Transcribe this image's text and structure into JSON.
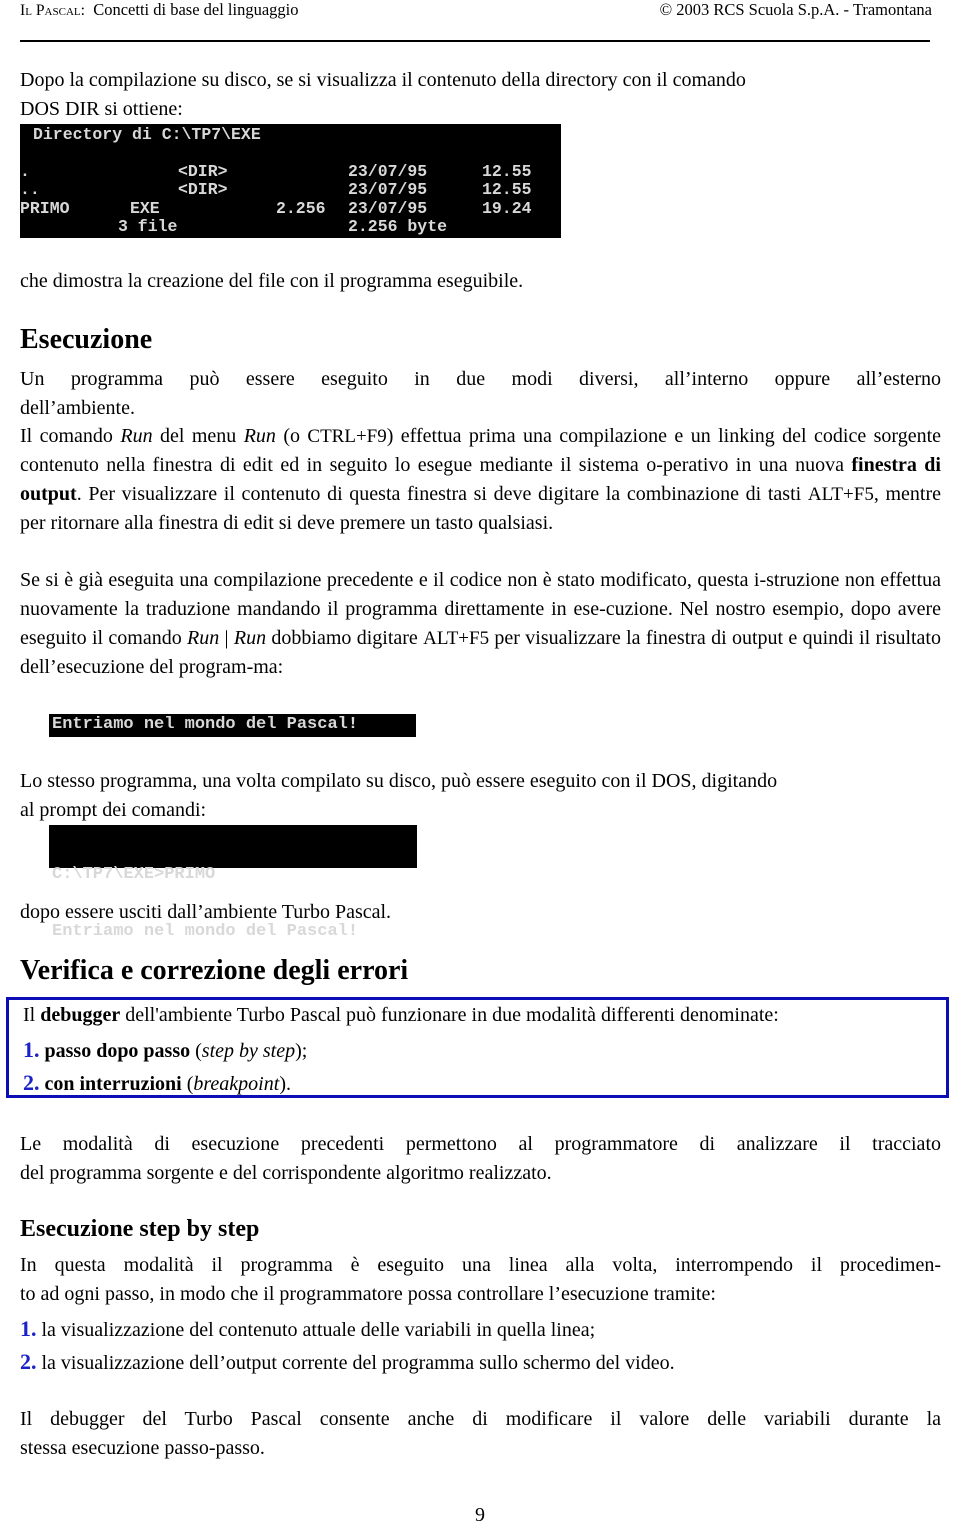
{
  "header": {
    "left_smallcaps": "Il Pascal:",
    "left_title": "Concetti di base del linguaggio",
    "right": "© 2003 RCS Scuola S.p.A. - Tramontana"
  },
  "intro": {
    "line1": "Dopo la compilazione su disco, se si visualizza il contenuto della directory con il comando",
    "line2": "DOS DIR si ottiene:"
  },
  "dir_listing": {
    "title": "Directory di C:\\TP7\\EXE",
    "rows": [
      {
        "name": ".",
        "ext": "",
        "type": "<DIR>",
        "size": "",
        "date": "23/07/95",
        "time": "12.55"
      },
      {
        "name": "..",
        "ext": "",
        "type": "<DIR>",
        "size": "",
        "date": "23/07/95",
        "time": "12.55"
      },
      {
        "name": "PRIMO",
        "ext": "EXE",
        "type": "",
        "size": "2.256",
        "date": "23/07/95",
        "time": "19.24"
      }
    ],
    "summary_files": "3 file",
    "summary_bytes": "2.256 byte"
  },
  "after_listing": "che dimostra la creazione del file con il programma eseguibile.",
  "section_esecuzione": {
    "title": "Esecuzione",
    "para1_line1": "Un programma può essere eseguito in due modi diversi, all’interno oppure all’esterno",
    "para1_line2": "dell’ambiente.",
    "para2": {
      "t1": "Il comando ",
      "run1": "Run",
      "t2": " del menu ",
      "run2": "Run",
      "t3": " (o ",
      "key1": "CTRL+F9",
      "t4": ") effettua prima una compilazione e un linking del codice sorgente contenuto nella finestra di edit ed in seguito lo esegue mediante il sistema o-perativo in una nuova ",
      "bold1": "finestra di output",
      "t5": ". Per visualizzare il contenuto di questa finestra si deve digitare la combinazione di tasti ",
      "key2": "ALT+F5",
      "t6": ", mentre per ritornare alla finestra di edit si deve premere un tasto qualsiasi."
    },
    "para3": {
      "t1": "Se si è già eseguita una compilazione precedente e il codice non è stato modificato, questa i-struzione non effettua nuovamente la traduzione mandando il programma direttamente in ese-cuzione.  Nel nostro esempio, dopo avere eseguito il comando ",
      "run1": "Run",
      "sep": " | ",
      "run2": "Run",
      "t2": " dobbiamo digitare ",
      "key": "ALT+F5",
      "t3": " per visualizzare la finestra di output e quindi il risultato dell’esecuzione del program-ma:"
    },
    "output_window": "Entriamo nel mondo del Pascal!",
    "para4_line1": "Lo stesso programma, una volta compilato su disco, può essere eseguito con il DOS, digitando",
    "para4_line2": "al prompt dei comandi:",
    "dos_prompt": "C:\\TP7\\EXE>PRIMO",
    "dos_output": "Entriamo nel mondo del Pascal!",
    "para5": "dopo essere usciti dall’ambiente Turbo Pascal."
  },
  "section_errori": {
    "title": "Verifica e correzione degli errori",
    "box": {
      "t1": "Il ",
      "bold": "debugger",
      "t2": " dell'ambiente Turbo Pascal può funzionare in due modalità differenti denominate:",
      "items": [
        {
          "num": "1.",
          "bold": "passo dopo passo",
          "open": " (",
          "ital": "step by step",
          "close": ");"
        },
        {
          "num": "2.",
          "bold": "con interruzioni",
          "open": " (",
          "ital": "breakpoint",
          "close": ")."
        }
      ]
    },
    "para1_line1": "Le modalità di esecuzione precedenti permettono al programmatore di analizzare il tracciato",
    "para1_line2": "del programma sorgente e del corrispondente algoritmo realizzato."
  },
  "section_step": {
    "title": "Esecuzione step by step",
    "para_line1": "In questa modalità il programma è eseguito una linea alla volta, interrompendo il procedimen-",
    "para_line2": "to ad ogni passo, in modo che il programmatore possa controllare l’esecuzione tramite:",
    "items": [
      {
        "num": "1.",
        "text": " la visualizzazione del contenuto attuale delle variabili in quella linea;"
      },
      {
        "num": "2.",
        "text": " la visualizzazione dell’output corrente del programma sullo schermo del video."
      }
    ],
    "final_line1": "Il debugger del Turbo Pascal consente anche di modificare il valore delle variabili durante la",
    "final_line2": "stessa esecuzione passo-passo."
  },
  "page_number": "9"
}
